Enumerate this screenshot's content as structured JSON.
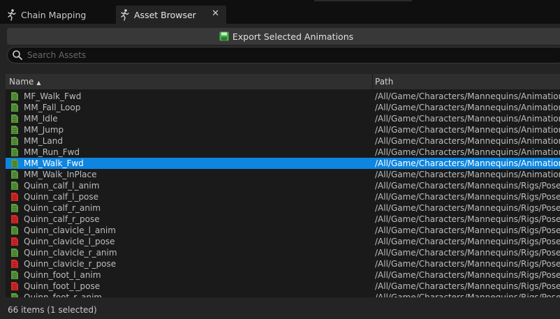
{
  "tabs": [
    {
      "label": "Chain Mapping",
      "icon": "running-figure-icon",
      "active": false
    },
    {
      "label": "Asset Browser",
      "icon": "running-figure-icon",
      "active": true,
      "close": "✕"
    }
  ],
  "toolbar": {
    "export_label": "Export Selected Animations",
    "export_icon": "save-disk-icon"
  },
  "search": {
    "placeholder": "Search Assets",
    "value": ""
  },
  "table": {
    "columns": [
      {
        "label": "Name",
        "sort": "ascending"
      },
      {
        "label": "Path"
      }
    ],
    "rows": [
      {
        "name": "MF_Walk_Fwd",
        "path": "/All/Game/Characters/Mannequins/Animations",
        "icon": "animation-sequence-icon",
        "kind": "anim",
        "selected": false
      },
      {
        "name": "MM_Fall_Loop",
        "path": "/All/Game/Characters/Mannequins/Animations",
        "icon": "animation-sequence-icon",
        "kind": "anim",
        "selected": false
      },
      {
        "name": "MM_Idle",
        "path": "/All/Game/Characters/Mannequins/Animations",
        "icon": "animation-sequence-icon",
        "kind": "anim",
        "selected": false
      },
      {
        "name": "MM_Jump",
        "path": "/All/Game/Characters/Mannequins/Animations",
        "icon": "animation-sequence-icon",
        "kind": "anim",
        "selected": false
      },
      {
        "name": "MM_Land",
        "path": "/All/Game/Characters/Mannequins/Animations",
        "icon": "animation-sequence-icon",
        "kind": "anim",
        "selected": false
      },
      {
        "name": "MM_Run_Fwd",
        "path": "/All/Game/Characters/Mannequins/Animations",
        "icon": "animation-sequence-icon",
        "kind": "anim",
        "selected": false
      },
      {
        "name": "MM_Walk_Fwd",
        "path": "/All/Game/Characters/Mannequins/Animations",
        "icon": "animation-sequence-icon",
        "kind": "anim",
        "selected": true
      },
      {
        "name": "MM_Walk_InPlace",
        "path": "/All/Game/Characters/Mannequins/Animations",
        "icon": "animation-sequence-icon",
        "kind": "anim",
        "selected": false
      },
      {
        "name": "Quinn_calf_l_anim",
        "path": "/All/Game/Characters/Mannequins/Rigs/Pose",
        "icon": "animation-sequence-icon",
        "kind": "anim",
        "selected": false
      },
      {
        "name": "Quinn_calf_l_pose",
        "path": "/All/Game/Characters/Mannequins/Rigs/Pose",
        "icon": "pose-asset-icon",
        "kind": "pose",
        "selected": false
      },
      {
        "name": "Quinn_calf_r_anim",
        "path": "/All/Game/Characters/Mannequins/Rigs/Pose",
        "icon": "animation-sequence-icon",
        "kind": "anim",
        "selected": false
      },
      {
        "name": "Quinn_calf_r_pose",
        "path": "/All/Game/Characters/Mannequins/Rigs/Pose",
        "icon": "pose-asset-icon",
        "kind": "pose",
        "selected": false
      },
      {
        "name": "Quinn_clavicle_l_anim",
        "path": "/All/Game/Characters/Mannequins/Rigs/Pose",
        "icon": "animation-sequence-icon",
        "kind": "anim",
        "selected": false
      },
      {
        "name": "Quinn_clavicle_l_pose",
        "path": "/All/Game/Characters/Mannequins/Rigs/Pose",
        "icon": "pose-asset-icon",
        "kind": "pose",
        "selected": false
      },
      {
        "name": "Quinn_clavicle_r_anim",
        "path": "/All/Game/Characters/Mannequins/Rigs/Pose",
        "icon": "animation-sequence-icon",
        "kind": "anim",
        "selected": false
      },
      {
        "name": "Quinn_clavicle_r_pose",
        "path": "/All/Game/Characters/Mannequins/Rigs/Pose",
        "icon": "pose-asset-icon",
        "kind": "pose",
        "selected": false
      },
      {
        "name": "Quinn_foot_l_anim",
        "path": "/All/Game/Characters/Mannequins/Rigs/Pose",
        "icon": "animation-sequence-icon",
        "kind": "anim",
        "selected": false
      },
      {
        "name": "Quinn_foot_l_pose",
        "path": "/All/Game/Characters/Mannequins/Rigs/Pose",
        "icon": "pose-asset-icon",
        "kind": "pose",
        "selected": false
      },
      {
        "name": "Quinn_foot_r_anim",
        "path": "/All/Game/Characters/Mannequins/Rigs/Pose",
        "icon": "animation-sequence-icon",
        "kind": "anim",
        "selected": false
      }
    ]
  },
  "status": {
    "text": "66 items (1 selected)"
  },
  "colors": {
    "selection": "#0e85e0",
    "anim_icon": "#5b9a3c",
    "pose_icon": "#d42a2a",
    "export_icon": "#4caf50"
  }
}
